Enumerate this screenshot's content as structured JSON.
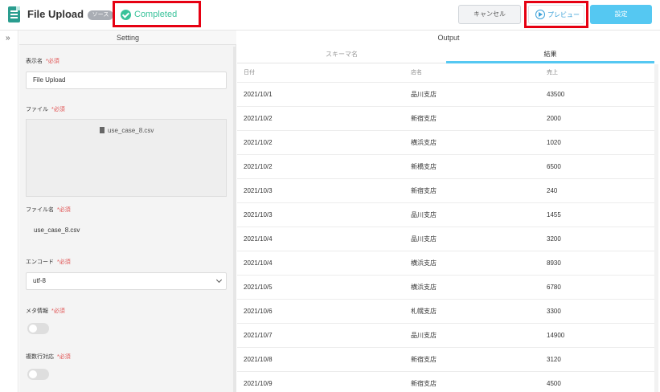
{
  "header": {
    "title": "File Upload",
    "badge": "ソース",
    "status": "Completed",
    "cancel_label": "キャンセル",
    "preview_label": "プレビュー",
    "setting_label": "設定",
    "accent_color": "#55c8f2",
    "status_color": "#39c29a",
    "highlight_color": "#e60012"
  },
  "settings": {
    "header": "Setting",
    "required_mark": "*必須",
    "display_name_label": "表示名",
    "display_name_value": "File Upload",
    "file_label": "ファイル",
    "uploaded_file": "use_case_8.csv",
    "file_name_label": "ファイル名",
    "file_name_value": "use_case_8.csv",
    "encoding_label": "エンコード",
    "encoding_value": "utf-8",
    "meta_label": "メタ情報",
    "multiline_label": "複数行対応"
  },
  "output": {
    "header": "Output",
    "tabs": [
      {
        "label": "スキーマ名"
      },
      {
        "label": "結果"
      }
    ],
    "columns": [
      "日付",
      "店名",
      "売上"
    ],
    "rows": [
      [
        "2021/10/1",
        "品川支店",
        "43500"
      ],
      [
        "2021/10/2",
        "新宿支店",
        "2000"
      ],
      [
        "2021/10/2",
        "横浜支店",
        "1020"
      ],
      [
        "2021/10/2",
        "新橋支店",
        "6500"
      ],
      [
        "2021/10/3",
        "新宿支店",
        "240"
      ],
      [
        "2021/10/3",
        "品川支店",
        "1455"
      ],
      [
        "2021/10/4",
        "品川支店",
        "3200"
      ],
      [
        "2021/10/4",
        "横浜支店",
        "8930"
      ],
      [
        "2021/10/5",
        "横浜支店",
        "6780"
      ],
      [
        "2021/10/6",
        "札幌支店",
        "3300"
      ],
      [
        "2021/10/7",
        "品川支店",
        "14900"
      ],
      [
        "2021/10/8",
        "新宿支店",
        "3120"
      ],
      [
        "2021/10/9",
        "新宿支店",
        "4500"
      ]
    ]
  }
}
